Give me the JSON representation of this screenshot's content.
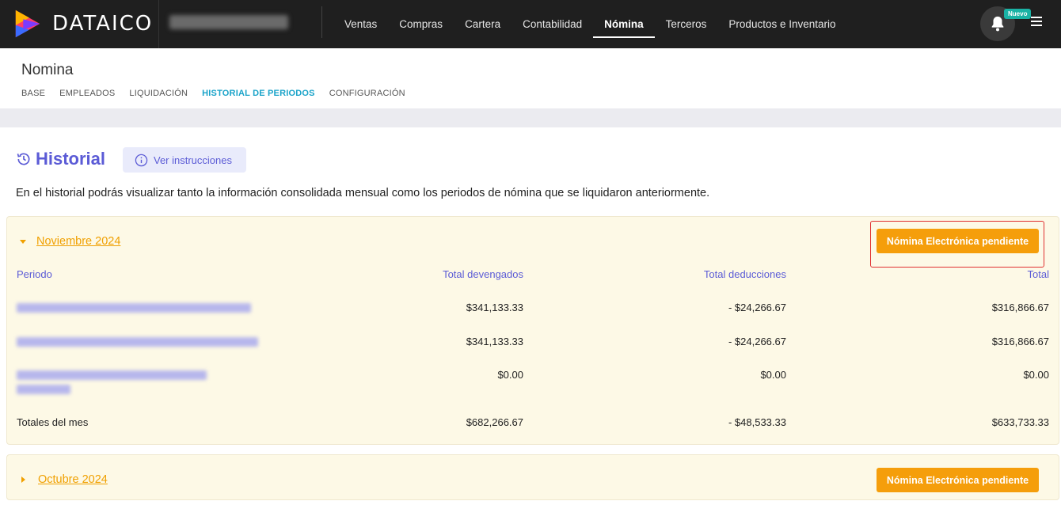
{
  "app": {
    "logo_text": "DATAICO",
    "nav": [
      {
        "label": "Ventas"
      },
      {
        "label": "Compras"
      },
      {
        "label": "Cartera"
      },
      {
        "label": "Contabilidad"
      },
      {
        "label": "Nómina",
        "active": true
      },
      {
        "label": "Terceros"
      },
      {
        "label": "Productos e Inventario"
      }
    ],
    "badge": "Nuevo"
  },
  "page": {
    "title": "Nomina",
    "tabs": [
      {
        "label": "BASE"
      },
      {
        "label": "EMPLEADOS"
      },
      {
        "label": "LIQUIDACIÓN"
      },
      {
        "label": "HISTORIAL DE PERIODOS",
        "active": true
      },
      {
        "label": "CONFIGURACIÓN"
      }
    ]
  },
  "historial": {
    "title": "Historial",
    "instructions_label": "Ver instrucciones",
    "description": "En el historial podrás visualizar tanto la información consolidada mensual como los periodos de nómina que se liquidaron anteriormente."
  },
  "months": [
    {
      "label": "Noviembre 2024",
      "expanded": true,
      "button_label": "Nómina Electrónica pendiente",
      "columns": {
        "period": "Periodo",
        "devengados": "Total devengados",
        "deducciones": "Total deducciones",
        "total": "Total"
      },
      "rows": [
        {
          "devengados": "$341,133.33",
          "deducciones": "- $24,266.67",
          "total": "$316,866.67"
        },
        {
          "devengados": "$341,133.33",
          "deducciones": "- $24,266.67",
          "total": "$316,866.67"
        },
        {
          "devengados": "$0.00",
          "deducciones": "$0.00",
          "total": "$0.00"
        }
      ],
      "totals": {
        "label": "Totales del mes",
        "devengados": "$682,266.67",
        "deducciones": "- $48,533.33",
        "total": "$633,733.33"
      }
    },
    {
      "label": "Octubre 2024",
      "expanded": false,
      "button_label": "Nómina Electrónica pendiente"
    }
  ],
  "colors": {
    "topbar": "#1f1f1f",
    "accent_purple": "#5b5bd6",
    "accent_teal": "#1aa3c9",
    "orange": "#f59e0b",
    "panel_bg": "#fdf9e6"
  }
}
